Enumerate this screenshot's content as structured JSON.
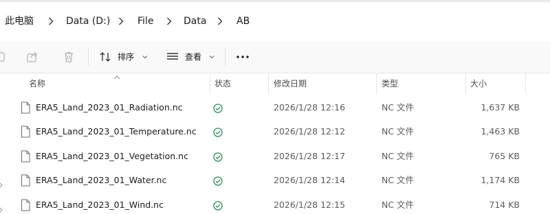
{
  "breadcrumb": {
    "items": [
      "此电脑",
      "Data (D:)",
      "File",
      "Data",
      "AB"
    ]
  },
  "toolbar": {
    "sort_label": "排序",
    "view_label": "查看",
    "more_label": "···"
  },
  "columns": {
    "name": "名称",
    "status": "状态",
    "date_modified": "修改日期",
    "type": "类型",
    "size": "大小"
  },
  "files": [
    {
      "name": "ERA5_Land_2023_01_Radiation.nc",
      "date": "2026/1/28 12:16",
      "type": "NC 文件",
      "size": "1,637 KB"
    },
    {
      "name": "ERA5_Land_2023_01_Temperature.nc",
      "date": "2026/1/28 12:12",
      "type": "NC 文件",
      "size": "1,463 KB"
    },
    {
      "name": "ERA5_Land_2023_01_Vegetation.nc",
      "date": "2026/1/28 12:17",
      "type": "NC 文件",
      "size": "765 KB"
    },
    {
      "name": "ERA5_Land_2023_01_Water.nc",
      "date": "2026/1/28 12:14",
      "type": "NC 文件",
      "size": "1,174 KB"
    },
    {
      "name": "ERA5_Land_2023_01_Wind.nc",
      "date": "2026/1/28 12:15",
      "type": "NC 文件",
      "size": "714 KB"
    }
  ],
  "colors": {
    "status_ok": "#2e8b57",
    "header_text": "#4a4a4a",
    "command_bar_bg": "#f9f9f9"
  }
}
